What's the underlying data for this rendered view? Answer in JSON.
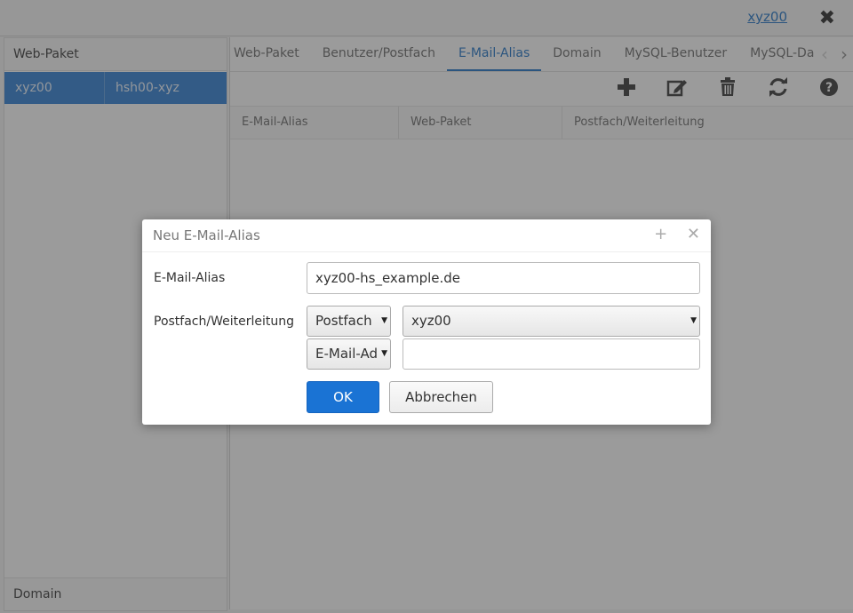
{
  "topbar": {
    "user_link": "xyz00",
    "close_icon": "close-icon"
  },
  "left_panel": {
    "header": "Web-Paket",
    "rows": [
      {
        "col1": "xyz00",
        "col2": "hsh00-xyz"
      }
    ],
    "footer": "Domain"
  },
  "tabs": [
    "Web-Paket",
    "Benutzer/Postfach",
    "E-Mail-Alias",
    "Domain",
    "MySQL-Benutzer",
    "MySQL-Da"
  ],
  "active_tab": "E-Mail-Alias",
  "toolbar": [
    "add-icon",
    "edit-icon",
    "trash-icon",
    "refresh-icon",
    "help-icon"
  ],
  "grid": {
    "columns": [
      "E-Mail-Alias",
      "Web-Paket",
      "Postfach/Weiterleitung"
    ]
  },
  "dialog": {
    "title": "Neu E-Mail-Alias",
    "alias_label": "E-Mail-Alias",
    "alias_value": "xyz00-hs_example.de",
    "target_label": "Postfach/Weiterleitung",
    "type_select_1": "Postfach",
    "mailbox_select": "xyz00",
    "type_select_2": "E-Mail-Ad",
    "address_value": "",
    "ok_label": "OK",
    "cancel_label": "Abbrechen"
  },
  "colors": {
    "accent": "#1a73d4",
    "selection": "#2a7ad0"
  }
}
